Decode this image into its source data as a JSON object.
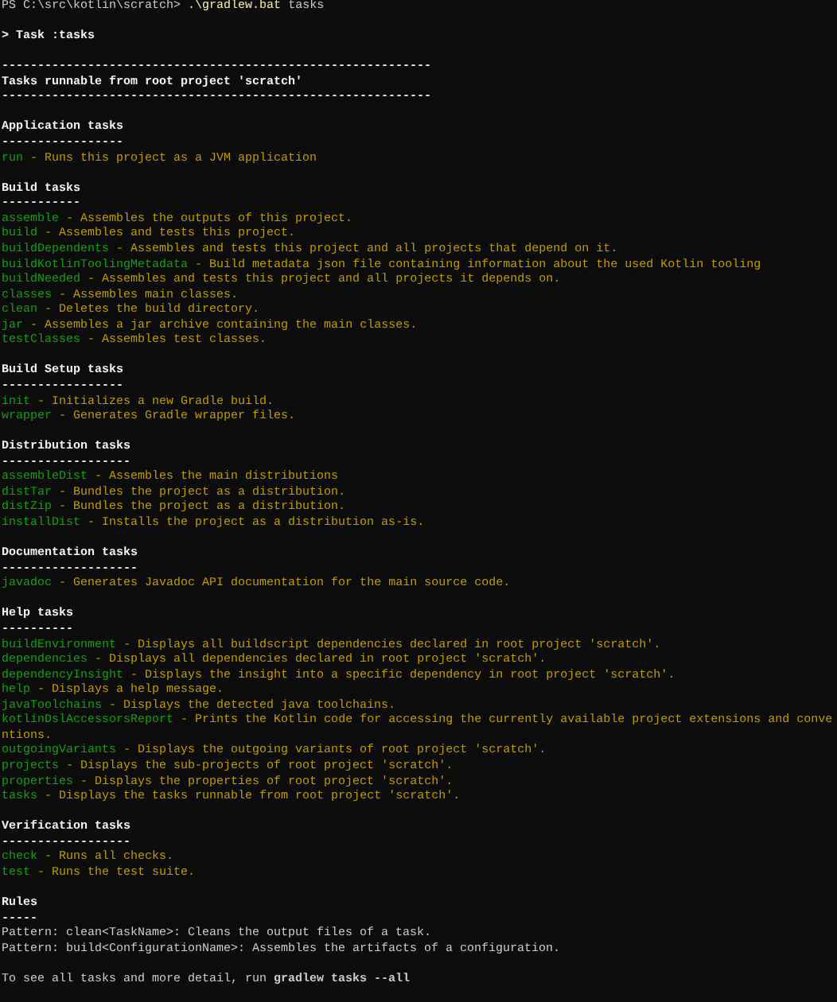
{
  "prompt": {
    "path": "PS C:\\src\\kotlin\\scratch>",
    "command": ".\\gradlew.bat",
    "argument": "tasks"
  },
  "task_header": "> Task :tasks",
  "banner": {
    "rule": "------------------------------------------------------------",
    "title": "Tasks runnable from root project 'scratch'"
  },
  "groups": [
    {
      "title": "Application tasks",
      "rule": "-----------------",
      "tasks": [
        {
          "name": "run",
          "description": "- Runs this project as a JVM application"
        }
      ]
    },
    {
      "title": "Build tasks",
      "rule": "-----------",
      "tasks": [
        {
          "name": "assemble",
          "description": "- Assembles the outputs of this project."
        },
        {
          "name": "build",
          "description": "- Assembles and tests this project."
        },
        {
          "name": "buildDependents",
          "description": "- Assembles and tests this project and all projects that depend on it."
        },
        {
          "name": "buildKotlinToolingMetadata",
          "description": "- Build metadata json file containing information about the used Kotlin tooling"
        },
        {
          "name": "buildNeeded",
          "description": "- Assembles and tests this project and all projects it depends on."
        },
        {
          "name": "classes",
          "description": "- Assembles main classes."
        },
        {
          "name": "clean",
          "description": "- Deletes the build directory."
        },
        {
          "name": "jar",
          "description": "- Assembles a jar archive containing the main classes."
        },
        {
          "name": "testClasses",
          "description": "- Assembles test classes."
        }
      ]
    },
    {
      "title": "Build Setup tasks",
      "rule": "-----------------",
      "tasks": [
        {
          "name": "init",
          "description": "- Initializes a new Gradle build."
        },
        {
          "name": "wrapper",
          "description": "- Generates Gradle wrapper files."
        }
      ]
    },
    {
      "title": "Distribution tasks",
      "rule": "------------------",
      "tasks": [
        {
          "name": "assembleDist",
          "description": "- Assembles the main distributions"
        },
        {
          "name": "distTar",
          "description": "- Bundles the project as a distribution."
        },
        {
          "name": "distZip",
          "description": "- Bundles the project as a distribution."
        },
        {
          "name": "installDist",
          "description": "- Installs the project as a distribution as-is."
        }
      ]
    },
    {
      "title": "Documentation tasks",
      "rule": "-------------------",
      "tasks": [
        {
          "name": "javadoc",
          "description": "- Generates Javadoc API documentation for the main source code."
        }
      ]
    },
    {
      "title": "Help tasks",
      "rule": "----------",
      "tasks": [
        {
          "name": "buildEnvironment",
          "description": "- Displays all buildscript dependencies declared in root project 'scratch'."
        },
        {
          "name": "dependencies",
          "description": "- Displays all dependencies declared in root project 'scratch'."
        },
        {
          "name": "dependencyInsight",
          "description": "- Displays the insight into a specific dependency in root project 'scratch'."
        },
        {
          "name": "help",
          "description": "- Displays a help message."
        },
        {
          "name": "javaToolchains",
          "description": "- Displays the detected java toolchains."
        },
        {
          "name": "kotlinDslAccessorsReport",
          "description": "- Prints the Kotlin code for accessing the currently available project extensions and conve",
          "continuation": "ntions."
        },
        {
          "name": "outgoingVariants",
          "description": "- Displays the outgoing variants of root project 'scratch'."
        },
        {
          "name": "projects",
          "description": "- Displays the sub-projects of root project 'scratch'."
        },
        {
          "name": "properties",
          "description": "- Displays the properties of root project 'scratch'."
        },
        {
          "name": "tasks",
          "description": "- Displays the tasks runnable from root project 'scratch'."
        }
      ]
    },
    {
      "title": "Verification tasks",
      "rule": "------------------",
      "tasks": [
        {
          "name": "check",
          "description": "- Runs all checks."
        },
        {
          "name": "test",
          "description": "- Runs the test suite."
        }
      ]
    }
  ],
  "rules": {
    "title": "Rules",
    "rule": "-----",
    "lines": [
      "Pattern: clean<TaskName>: Cleans the output files of a task.",
      "Pattern: build<ConfigurationName>: Assembles the artifacts of a configuration."
    ]
  },
  "footer": "To see all tasks and more detail, run **gradlew tasks --all**"
}
